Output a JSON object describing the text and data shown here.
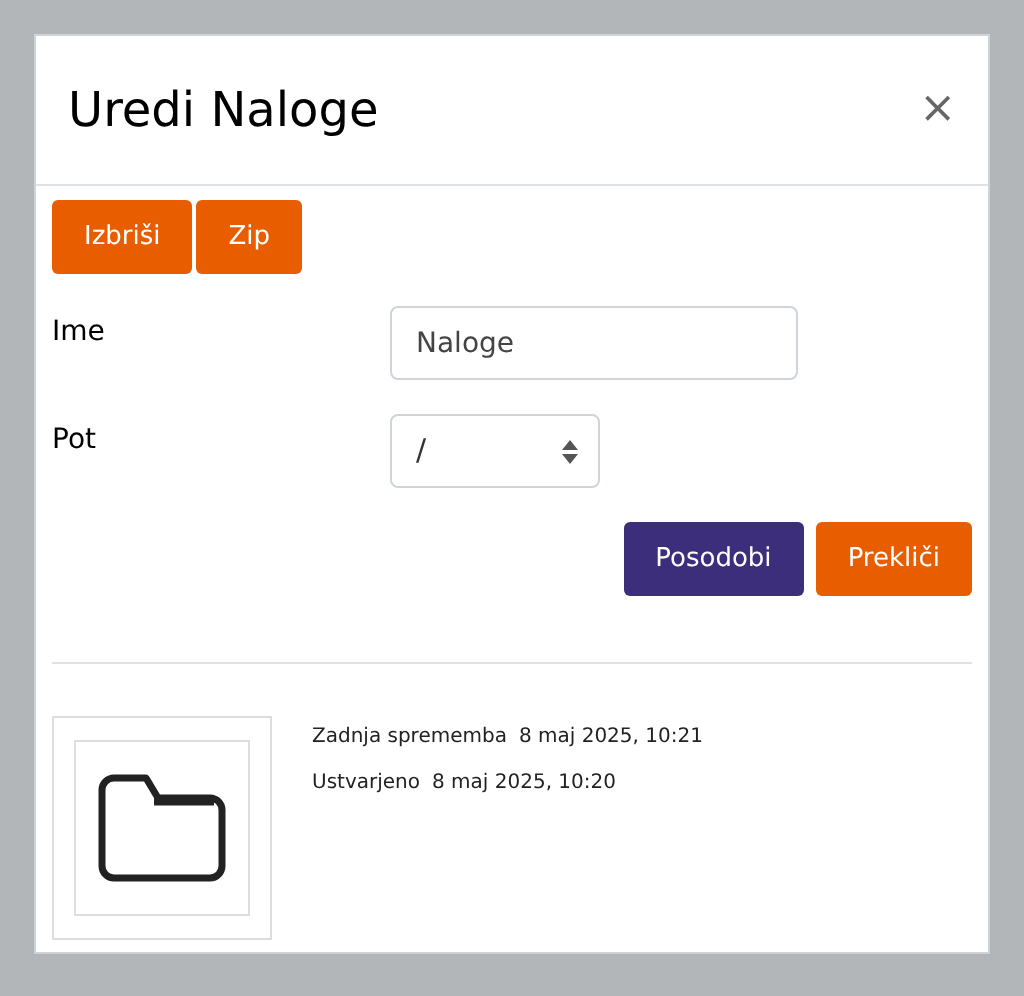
{
  "dialog": {
    "title": "Uredi Naloge",
    "close": "×"
  },
  "toolbar": [
    "Izbriši",
    "Zip"
  ],
  "fields": [
    {
      "kind": "text",
      "label": "Ime",
      "value": "Naloge"
    },
    {
      "kind": "select",
      "label": "Pot",
      "value": "/"
    }
  ],
  "actions": [
    {
      "label": "Posodobi",
      "kind": "primary"
    },
    {
      "label": "Prekliči",
      "kind": "secondary"
    }
  ],
  "details": [
    {
      "label": "Zadnja sprememba",
      "value": "8 maj 2025, 10:21"
    },
    {
      "label": "Ustvarjeno",
      "value": "8 maj 2025, 10:20"
    }
  ]
}
